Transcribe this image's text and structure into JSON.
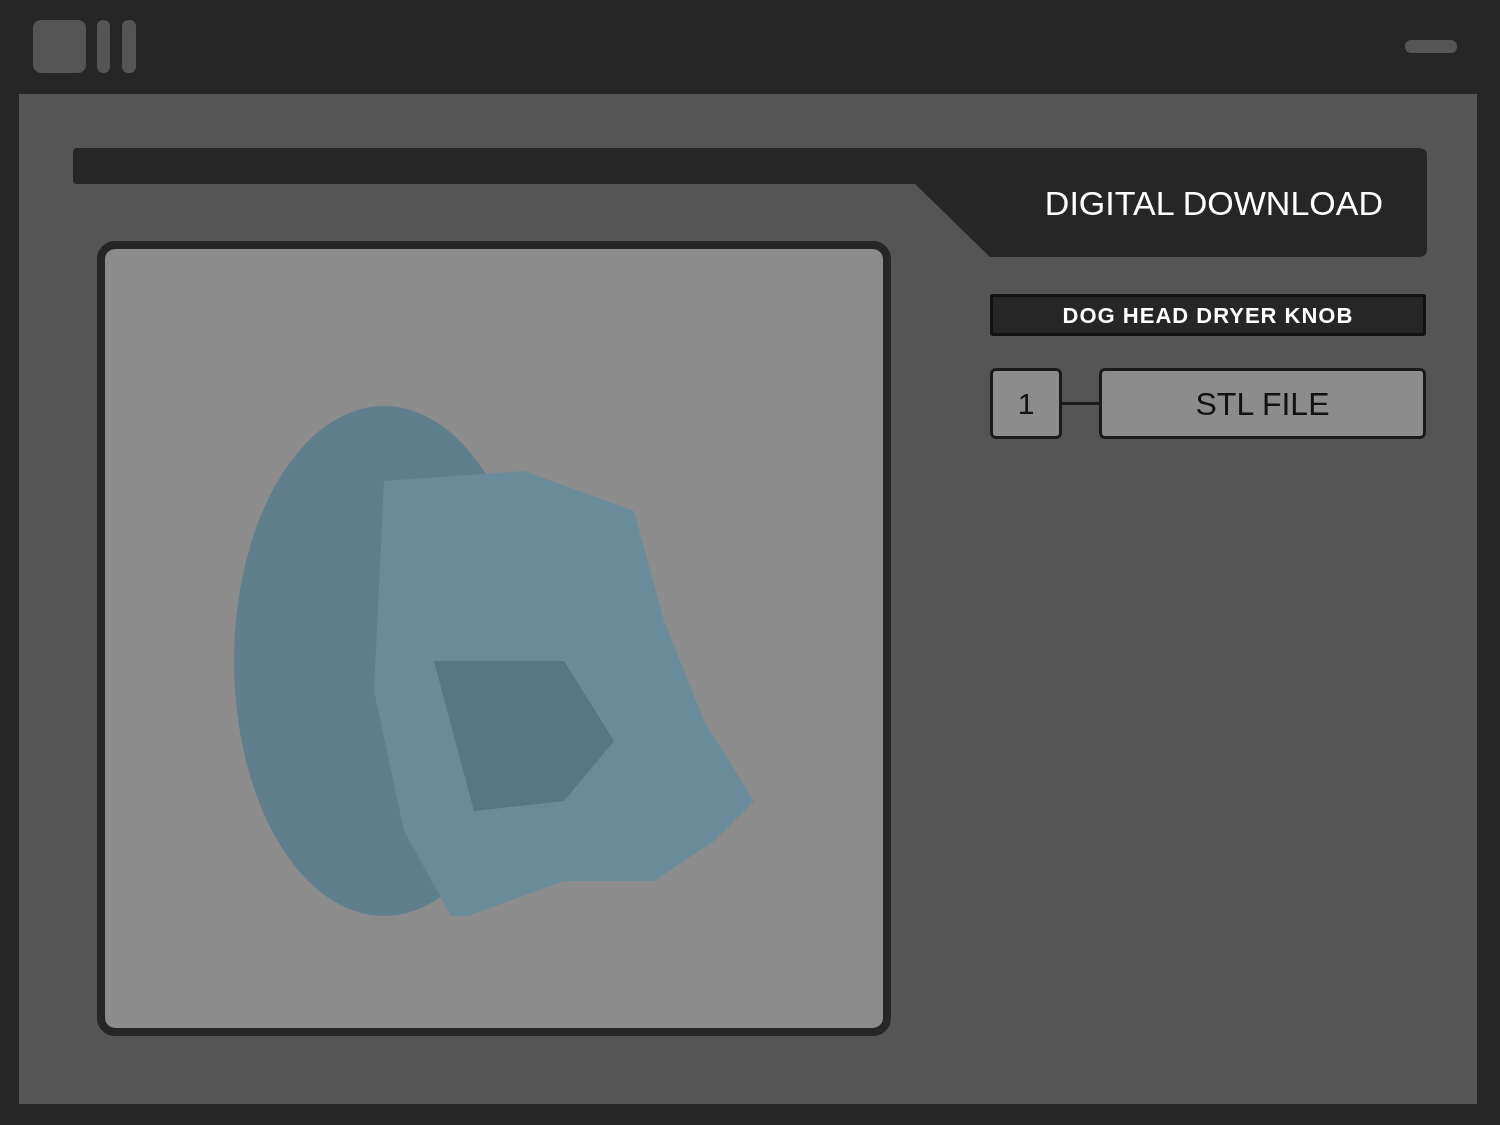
{
  "banner": {
    "title": "DIGITAL DOWNLOAD"
  },
  "product": {
    "name": "DOG HEAD DRYER KNOB"
  },
  "download": {
    "quantity": "1",
    "file_type": "STL FILE"
  }
}
